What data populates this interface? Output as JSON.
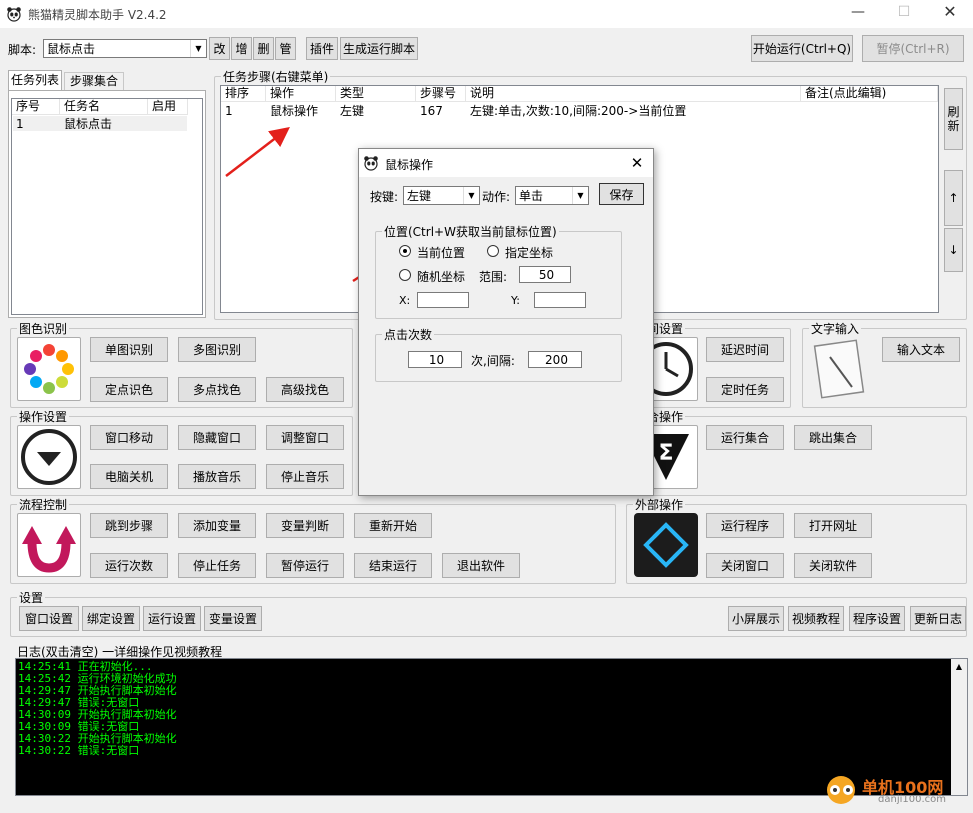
{
  "window": {
    "title": "熊猫精灵脚本助手  V2.4.2"
  },
  "toolbar": {
    "script_label": "脚本:",
    "script_value": "鼠标点击",
    "btn_edit": "改",
    "btn_add": "增",
    "btn_delete": "删",
    "btn_manage": "管",
    "btn_plugin": "插件",
    "btn_generate": "生成运行脚本",
    "btn_start": "开始运行(Ctrl+Q)",
    "btn_pause": "暂停(Ctrl+R)"
  },
  "left_tabs": [
    "任务列表",
    "步骤集合"
  ],
  "task_list": {
    "headers": [
      "序号",
      "任务名",
      "启用"
    ],
    "rows": [
      {
        "no": "1",
        "name": "鼠标点击",
        "enabled": ""
      }
    ]
  },
  "steps": {
    "title": "任务步骤(右键菜单)",
    "headers": [
      "排序",
      "操作",
      "类型",
      "步骤号",
      "说明",
      "备注(点此编辑)"
    ],
    "rows": [
      {
        "order": "1",
        "op": "鼠标操作",
        "type": "左键",
        "step": "167",
        "desc": "左键:单击,次数:10,间隔:200->当前位置",
        "note": ""
      }
    ]
  },
  "side_buttons": {
    "refresh": "刷新",
    "up": "↑",
    "down": "↓"
  },
  "groups": {
    "image": {
      "title": "图色识别",
      "b1": "单图识别",
      "b2": "多图识别",
      "b3": "定点识色",
      "b4": "多点找色",
      "b5": "高级找色"
    },
    "time": {
      "title": "时间设置",
      "b1": "延迟时间",
      "b2": "定时任务"
    },
    "text": {
      "title": "文字输入",
      "b1": "输入文本"
    },
    "op": {
      "title": "操作设置",
      "b1": "窗口移动",
      "b2": "隐藏窗口",
      "b3": "调整窗口",
      "b4": "电脑关机",
      "b5": "播放音乐",
      "b6": "停止音乐"
    },
    "set": {
      "title": "集合操作",
      "b1": "运行集合",
      "b2": "跳出集合"
    },
    "flow": {
      "title": "流程控制",
      "b1": "跳到步骤",
      "b2": "添加变量",
      "b3": "变量判断",
      "b4": "重新开始",
      "b5": "运行次数",
      "b6": "停止任务",
      "b7": "暂停运行",
      "b8": "结束运行",
      "b9": "退出软件"
    },
    "ext": {
      "title": "外部操作",
      "b1": "运行程序",
      "b2": "打开网址",
      "b3": "关闭窗口",
      "b4": "关闭软件"
    },
    "settings": {
      "title": "设置",
      "b1": "窗口设置",
      "b2": "绑定设置",
      "b3": "运行设置",
      "b4": "变量设置",
      "b5": "小屏展示",
      "b6": "视频教程",
      "b7": "程序设置",
      "b8": "更新日志"
    }
  },
  "log": {
    "title": "日志(双击清空)    一详细操作见视频教程",
    "lines": [
      "14:25:41  正在初始化...",
      "14:25:42  运行环境初始化成功",
      "14:29:47  开始执行脚本初始化",
      "14:29:47  错误:无窗口",
      "14:30:09  开始执行脚本初始化",
      "14:30:09  错误:无窗口",
      "14:30:22  开始执行脚本初始化",
      "14:30:22  错误:无窗口"
    ]
  },
  "dialog": {
    "title": "鼠标操作",
    "key_label": "按键:",
    "key_value": "左键",
    "action_label": "动作:",
    "action_value": "单击",
    "save": "保存",
    "pos_title": "位置(Ctrl+W获取当前鼠标位置)",
    "opt_current": "当前位置",
    "opt_specified": "指定坐标",
    "opt_random": "随机坐标",
    "range_label": "范围:",
    "range_value": "50",
    "x_label": "X:",
    "x_value": "",
    "y_label": "Y:",
    "y_value": "",
    "clicks_title": "点击次数",
    "clicks_value": "10",
    "interval_label": "次,间隔:",
    "interval_value": "200"
  },
  "watermark": {
    "name": "单机100网",
    "url": "danji100.com"
  },
  "colors": {
    "accent": "#0078d7",
    "log_text": "#00ff00",
    "arrow": "#e3201b"
  }
}
